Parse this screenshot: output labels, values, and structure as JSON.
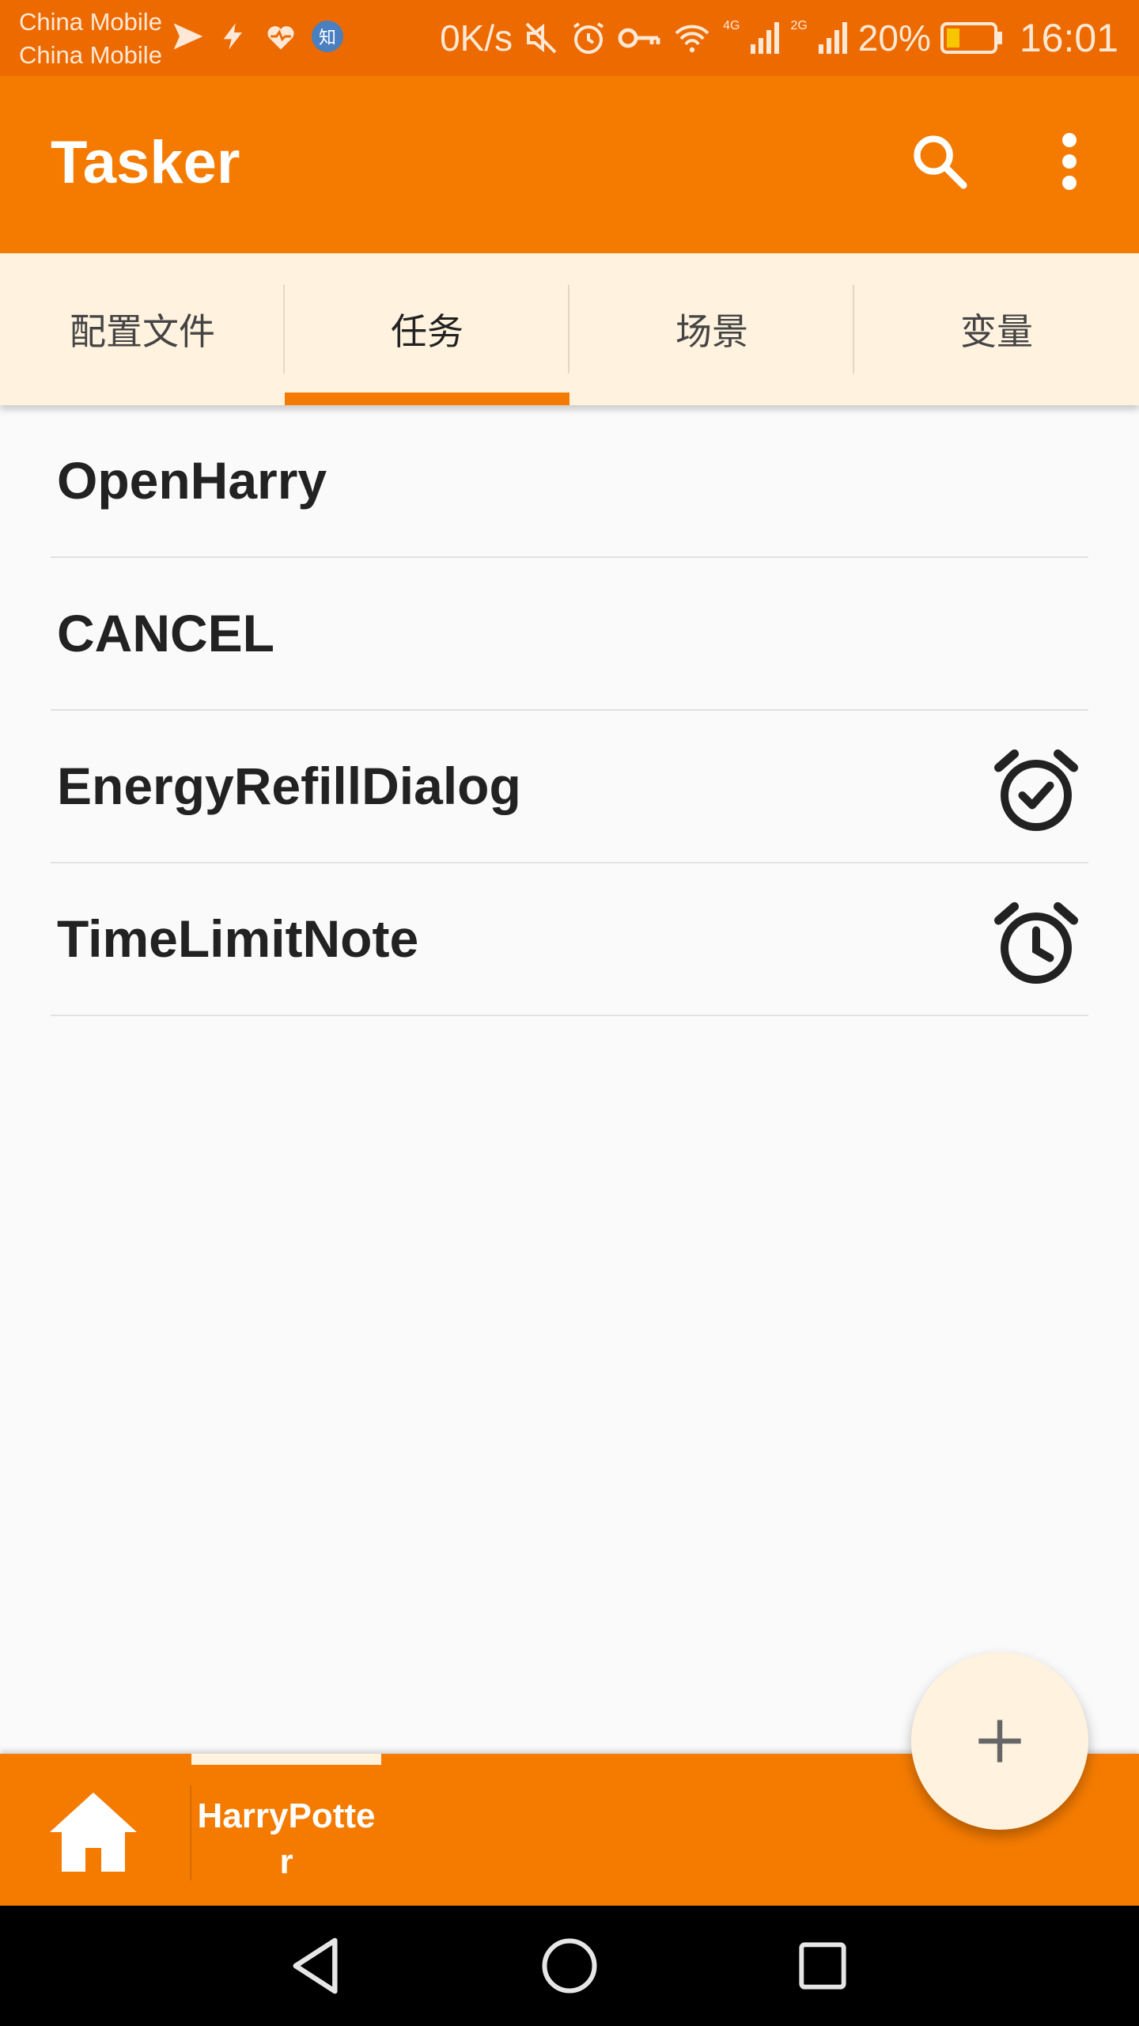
{
  "status_bar": {
    "carrier_1": "China Mobile",
    "carrier_2": "China Mobile",
    "speed": "0K/s",
    "net_1": "4G",
    "net_2": "2G",
    "battery_pct": "20%",
    "time": "16:01",
    "left_icons": [
      "send-icon",
      "flash-icon",
      "heart-rate-icon",
      "zhihu-icon"
    ],
    "zhihu_badge": "知",
    "right_icons": [
      "mute-icon",
      "alarm-icon",
      "key-icon",
      "wifi-icon",
      "signal-icon",
      "signal-icon",
      "battery-icon"
    ]
  },
  "app_bar": {
    "title": "Tasker",
    "icons": [
      "search-icon",
      "more-vert-icon"
    ]
  },
  "tabs": [
    {
      "label": "配置文件",
      "active": false
    },
    {
      "label": "任务",
      "active": true
    },
    {
      "label": "场景",
      "active": false
    },
    {
      "label": "变量",
      "active": false
    }
  ],
  "tasks": [
    {
      "name": "OpenHarry",
      "icon": ""
    },
    {
      "name": "CANCEL",
      "icon": ""
    },
    {
      "name": "EnergyRefillDialog",
      "icon": "alarm-check-icon"
    },
    {
      "name": "TimeLimitNote",
      "icon": "alarm-clock-icon"
    }
  ],
  "project_bar": {
    "home_icon": "home-icon",
    "project_name": "HarryPotter"
  },
  "fab": {
    "icon": "plus-icon"
  },
  "nav_bar": {
    "icons": [
      "back-icon",
      "home-circle-icon",
      "recents-icon"
    ]
  },
  "colors": {
    "status_bar": "#ec6a00",
    "primary": "#f47b00",
    "tab_background": "#fff2df",
    "fab": "#fff2df",
    "list_background": "#fafafa"
  }
}
